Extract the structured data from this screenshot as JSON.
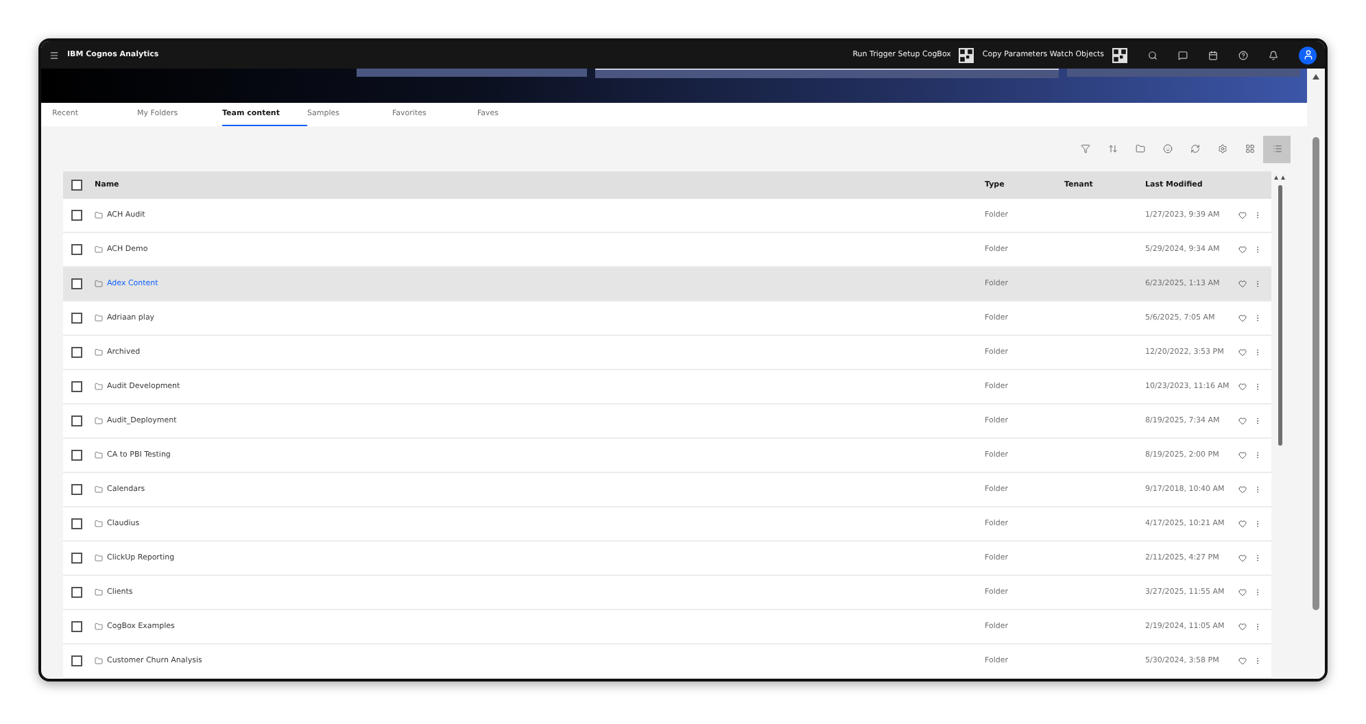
{
  "header": {
    "title": "IBM Cognos Analytics",
    "actions": [
      {
        "label": "Run Trigger Setup CogBox"
      },
      {
        "label": "Copy Parameters Watch Objects"
      }
    ]
  },
  "tabs": [
    {
      "label": "Recent",
      "selected": false
    },
    {
      "label": "My Folders",
      "selected": false
    },
    {
      "label": "Team content",
      "selected": true
    },
    {
      "label": "Samples",
      "selected": false
    },
    {
      "label": "Favorites",
      "selected": false
    },
    {
      "label": "Faves",
      "selected": false
    }
  ],
  "toolbar": [
    {
      "kind": "filter",
      "selected": false
    },
    {
      "kind": "sort",
      "selected": false
    },
    {
      "kind": "folder",
      "selected": false
    },
    {
      "kind": "face",
      "selected": false
    },
    {
      "kind": "refresh",
      "selected": false
    },
    {
      "kind": "settings",
      "selected": false
    },
    {
      "kind": "grid",
      "selected": false
    },
    {
      "kind": "list",
      "selected": true
    }
  ],
  "table": {
    "columns": [
      "Name",
      "Type",
      "Tenant",
      "Last Modified"
    ],
    "all_checked": false,
    "rows": [
      {
        "name": "ACH Audit",
        "type": "Folder",
        "modified": "1/27/2023, 9:39 AM",
        "hovered": false,
        "checked": false
      },
      {
        "name": "ACH Demo",
        "type": "Folder",
        "modified": "5/29/2024, 9:34 AM",
        "hovered": false,
        "checked": false
      },
      {
        "name": "Adex Content",
        "type": "Folder",
        "modified": "6/23/2025, 1:13 AM",
        "hovered": true,
        "checked": false
      },
      {
        "name": "Adriaan play",
        "type": "Folder",
        "modified": "5/6/2025, 7:05 AM",
        "hovered": false,
        "checked": false
      },
      {
        "name": "Archived",
        "type": "Folder",
        "modified": "12/20/2022, 3:53 PM",
        "hovered": false,
        "checked": false
      },
      {
        "name": "Audit Development",
        "type": "Folder",
        "modified": "10/23/2023, 11:16 AM",
        "hovered": false,
        "checked": false
      },
      {
        "name": "Audit_Deployment",
        "type": "Folder",
        "modified": "8/19/2025, 7:34 AM",
        "hovered": false,
        "checked": false
      },
      {
        "name": "CA to PBI Testing",
        "type": "Folder",
        "modified": "8/19/2025, 2:00 PM",
        "hovered": false,
        "checked": false
      },
      {
        "name": "Calendars",
        "type": "Folder",
        "modified": "9/17/2018, 10:40 AM",
        "hovered": false,
        "checked": false
      },
      {
        "name": "Claudius",
        "type": "Folder",
        "modified": "4/17/2025, 10:21 AM",
        "hovered": false,
        "checked": false
      },
      {
        "name": "ClickUp Reporting",
        "type": "Folder",
        "modified": "2/11/2025, 4:27 PM",
        "hovered": false,
        "checked": false
      },
      {
        "name": "Clients",
        "type": "Folder",
        "modified": "3/27/2025, 11:55 AM",
        "hovered": false,
        "checked": false
      },
      {
        "name": "CogBox Examples",
        "type": "Folder",
        "modified": "2/19/2024, 11:05 AM",
        "hovered": false,
        "checked": false
      },
      {
        "name": "Customer Churn Analysis",
        "type": "Folder",
        "modified": "5/30/2024, 3:58 PM",
        "hovered": false,
        "checked": false
      }
    ]
  }
}
